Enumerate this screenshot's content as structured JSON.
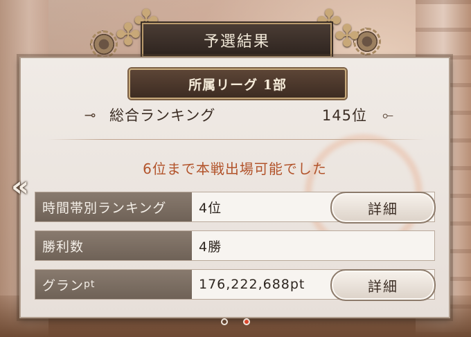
{
  "header": {
    "title": "予選結果"
  },
  "league": {
    "label": "所属リーグ 1部"
  },
  "overall": {
    "label": "総合ランキング",
    "value": "145位",
    "deco_left": "⊸",
    "deco_right": "⟜"
  },
  "notice": "6位まで本戦出場可能でした",
  "stats": [
    {
      "label": "時間帯別ランキング",
      "value": "4位",
      "button": "詳細"
    },
    {
      "label": "勝利数",
      "value": "4勝"
    },
    {
      "label": "グラン",
      "label_unit": "pt",
      "value": "176,222,688pt",
      "button": "詳細"
    }
  ],
  "nav": {
    "prev_icon": "«"
  },
  "pager": {
    "count": 2,
    "active_index": 1
  },
  "colors": {
    "notice": "#b2532a",
    "label_bg": "#7c6e62",
    "active_dot": "#d9472e"
  }
}
